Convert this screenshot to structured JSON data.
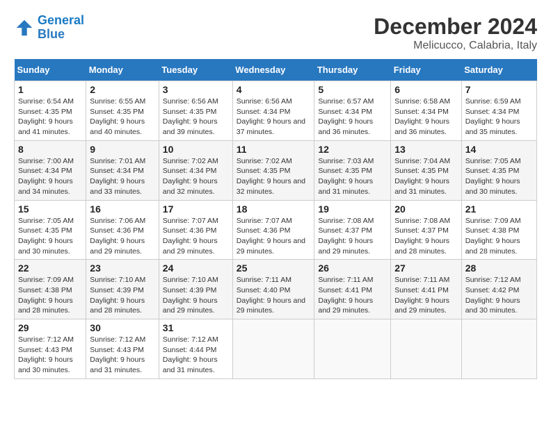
{
  "logo": {
    "line1": "General",
    "line2": "Blue"
  },
  "title": "December 2024",
  "subtitle": "Melicucco, Calabria, Italy",
  "days_header": [
    "Sunday",
    "Monday",
    "Tuesday",
    "Wednesday",
    "Thursday",
    "Friday",
    "Saturday"
  ],
  "weeks": [
    [
      {
        "day": "1",
        "sunrise": "6:54 AM",
        "sunset": "4:35 PM",
        "daylight": "9 hours and 41 minutes."
      },
      {
        "day": "2",
        "sunrise": "6:55 AM",
        "sunset": "4:35 PM",
        "daylight": "9 hours and 40 minutes."
      },
      {
        "day": "3",
        "sunrise": "6:56 AM",
        "sunset": "4:35 PM",
        "daylight": "9 hours and 39 minutes."
      },
      {
        "day": "4",
        "sunrise": "6:56 AM",
        "sunset": "4:34 PM",
        "daylight": "9 hours and 37 minutes."
      },
      {
        "day": "5",
        "sunrise": "6:57 AM",
        "sunset": "4:34 PM",
        "daylight": "9 hours and 36 minutes."
      },
      {
        "day": "6",
        "sunrise": "6:58 AM",
        "sunset": "4:34 PM",
        "daylight": "9 hours and 36 minutes."
      },
      {
        "day": "7",
        "sunrise": "6:59 AM",
        "sunset": "4:34 PM",
        "daylight": "9 hours and 35 minutes."
      }
    ],
    [
      {
        "day": "8",
        "sunrise": "7:00 AM",
        "sunset": "4:34 PM",
        "daylight": "9 hours and 34 minutes."
      },
      {
        "day": "9",
        "sunrise": "7:01 AM",
        "sunset": "4:34 PM",
        "daylight": "9 hours and 33 minutes."
      },
      {
        "day": "10",
        "sunrise": "7:02 AM",
        "sunset": "4:34 PM",
        "daylight": "9 hours and 32 minutes."
      },
      {
        "day": "11",
        "sunrise": "7:02 AM",
        "sunset": "4:35 PM",
        "daylight": "9 hours and 32 minutes."
      },
      {
        "day": "12",
        "sunrise": "7:03 AM",
        "sunset": "4:35 PM",
        "daylight": "9 hours and 31 minutes."
      },
      {
        "day": "13",
        "sunrise": "7:04 AM",
        "sunset": "4:35 PM",
        "daylight": "9 hours and 31 minutes."
      },
      {
        "day": "14",
        "sunrise": "7:05 AM",
        "sunset": "4:35 PM",
        "daylight": "9 hours and 30 minutes."
      }
    ],
    [
      {
        "day": "15",
        "sunrise": "7:05 AM",
        "sunset": "4:35 PM",
        "daylight": "9 hours and 30 minutes."
      },
      {
        "day": "16",
        "sunrise": "7:06 AM",
        "sunset": "4:36 PM",
        "daylight": "9 hours and 29 minutes."
      },
      {
        "day": "17",
        "sunrise": "7:07 AM",
        "sunset": "4:36 PM",
        "daylight": "9 hours and 29 minutes."
      },
      {
        "day": "18",
        "sunrise": "7:07 AM",
        "sunset": "4:36 PM",
        "daylight": "9 hours and 29 minutes."
      },
      {
        "day": "19",
        "sunrise": "7:08 AM",
        "sunset": "4:37 PM",
        "daylight": "9 hours and 29 minutes."
      },
      {
        "day": "20",
        "sunrise": "7:08 AM",
        "sunset": "4:37 PM",
        "daylight": "9 hours and 28 minutes."
      },
      {
        "day": "21",
        "sunrise": "7:09 AM",
        "sunset": "4:38 PM",
        "daylight": "9 hours and 28 minutes."
      }
    ],
    [
      {
        "day": "22",
        "sunrise": "7:09 AM",
        "sunset": "4:38 PM",
        "daylight": "9 hours and 28 minutes."
      },
      {
        "day": "23",
        "sunrise": "7:10 AM",
        "sunset": "4:39 PM",
        "daylight": "9 hours and 28 minutes."
      },
      {
        "day": "24",
        "sunrise": "7:10 AM",
        "sunset": "4:39 PM",
        "daylight": "9 hours and 29 minutes."
      },
      {
        "day": "25",
        "sunrise": "7:11 AM",
        "sunset": "4:40 PM",
        "daylight": "9 hours and 29 minutes."
      },
      {
        "day": "26",
        "sunrise": "7:11 AM",
        "sunset": "4:41 PM",
        "daylight": "9 hours and 29 minutes."
      },
      {
        "day": "27",
        "sunrise": "7:11 AM",
        "sunset": "4:41 PM",
        "daylight": "9 hours and 29 minutes."
      },
      {
        "day": "28",
        "sunrise": "7:12 AM",
        "sunset": "4:42 PM",
        "daylight": "9 hours and 30 minutes."
      }
    ],
    [
      {
        "day": "29",
        "sunrise": "7:12 AM",
        "sunset": "4:43 PM",
        "daylight": "9 hours and 30 minutes."
      },
      {
        "day": "30",
        "sunrise": "7:12 AM",
        "sunset": "4:43 PM",
        "daylight": "9 hours and 31 minutes."
      },
      {
        "day": "31",
        "sunrise": "7:12 AM",
        "sunset": "4:44 PM",
        "daylight": "9 hours and 31 minutes."
      },
      null,
      null,
      null,
      null
    ]
  ]
}
